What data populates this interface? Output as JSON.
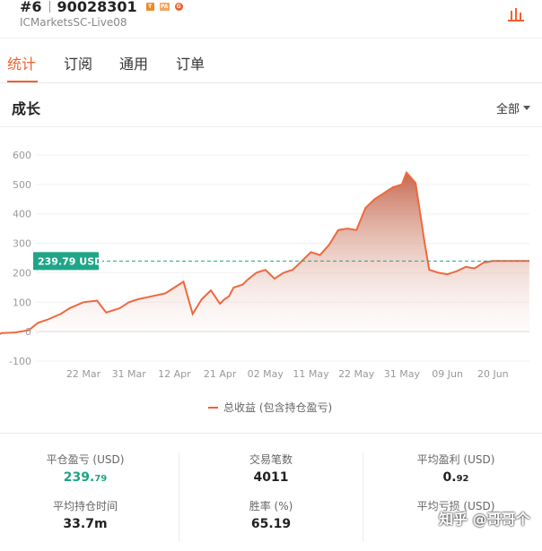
{
  "header": {
    "rank": "#6",
    "account_number": "90028301",
    "badges": [
      "T",
      "PA",
      "G"
    ],
    "server": "ICMarketsSC-Live08"
  },
  "tabs": [
    {
      "label": "统计",
      "active": true
    },
    {
      "label": "订阅",
      "active": false
    },
    {
      "label": "通用",
      "active": false
    },
    {
      "label": "订单",
      "active": false
    }
  ],
  "section": {
    "title": "成长",
    "range_label": "全部"
  },
  "chart_data": {
    "type": "area",
    "y_ticks": [
      600,
      500,
      400,
      300,
      200,
      100,
      0,
      -100
    ],
    "ylim": [
      -100,
      600
    ],
    "x_ticks": [
      "22 Mar",
      "31 Mar",
      "12 Apr",
      "21 Apr",
      "02 May",
      "11 May",
      "22 May",
      "31 May",
      "09 Jun",
      "20 Jun"
    ],
    "current_label": "239.79 USD",
    "current_value": 239.79,
    "series": [
      {
        "name": "总收益 (包含持仓盈亏)",
        "x_tick_index": [
          -2.8,
          -2.6,
          -2.4,
          -2.2,
          -2.0,
          -1.8,
          -1.5,
          -1.2,
          -1.0,
          -0.8,
          -0.5,
          -0.3,
          0.0,
          0.3,
          0.5,
          0.8,
          1.0,
          1.2,
          1.5,
          1.8,
          2.0,
          2.2,
          2.4,
          2.6,
          2.8,
          3.0,
          3.1,
          3.2,
          3.3,
          3.5,
          3.6,
          3.8,
          4.0,
          4.1,
          4.2,
          4.4,
          4.6,
          4.8,
          5.0,
          5.2,
          5.4,
          5.6,
          5.8,
          6.0,
          6.2,
          6.4,
          6.6,
          6.8,
          7.0,
          7.1,
          7.3,
          7.5,
          7.6,
          7.8,
          8.0,
          8.2,
          8.4,
          8.6,
          8.8,
          9.0,
          9.2,
          9.5,
          9.8
        ],
        "values": [
          0,
          10,
          -50,
          -35,
          -20,
          -5,
          -3,
          5,
          30,
          40,
          60,
          80,
          100,
          105,
          65,
          80,
          100,
          110,
          120,
          130,
          150,
          170,
          60,
          110,
          140,
          95,
          110,
          120,
          150,
          160,
          175,
          200,
          210,
          195,
          180,
          200,
          210,
          240,
          270,
          260,
          295,
          345,
          350,
          345,
          420,
          450,
          470,
          490,
          500,
          540,
          505,
          300,
          210,
          200,
          195,
          205,
          220,
          215,
          235,
          240,
          240,
          240,
          240
        ]
      }
    ]
  },
  "legend_label": "总收益 (包含持仓盈亏)",
  "stats": [
    {
      "label": "平仓盈亏 (USD)",
      "value_main": "239.",
      "value_small": "79",
      "highlight": "green"
    },
    {
      "label": "交易笔数",
      "value_main": "4011",
      "value_small": ""
    },
    {
      "label": "平均盈利 (USD)",
      "value_main": "0.",
      "value_small": "92"
    },
    {
      "label": "平均持仓时间",
      "value_main": "33.7m",
      "value_small": ""
    },
    {
      "label": "胜率 (%)",
      "value_main": "65.19",
      "value_small": ""
    },
    {
      "label": "平均亏损 (USD)",
      "value_main": "",
      "value_small": ""
    }
  ],
  "watermark": "知乎 @哥哥个",
  "colors": {
    "accent": "#f2612c",
    "green": "#1fa587",
    "line": "#f0683e"
  }
}
